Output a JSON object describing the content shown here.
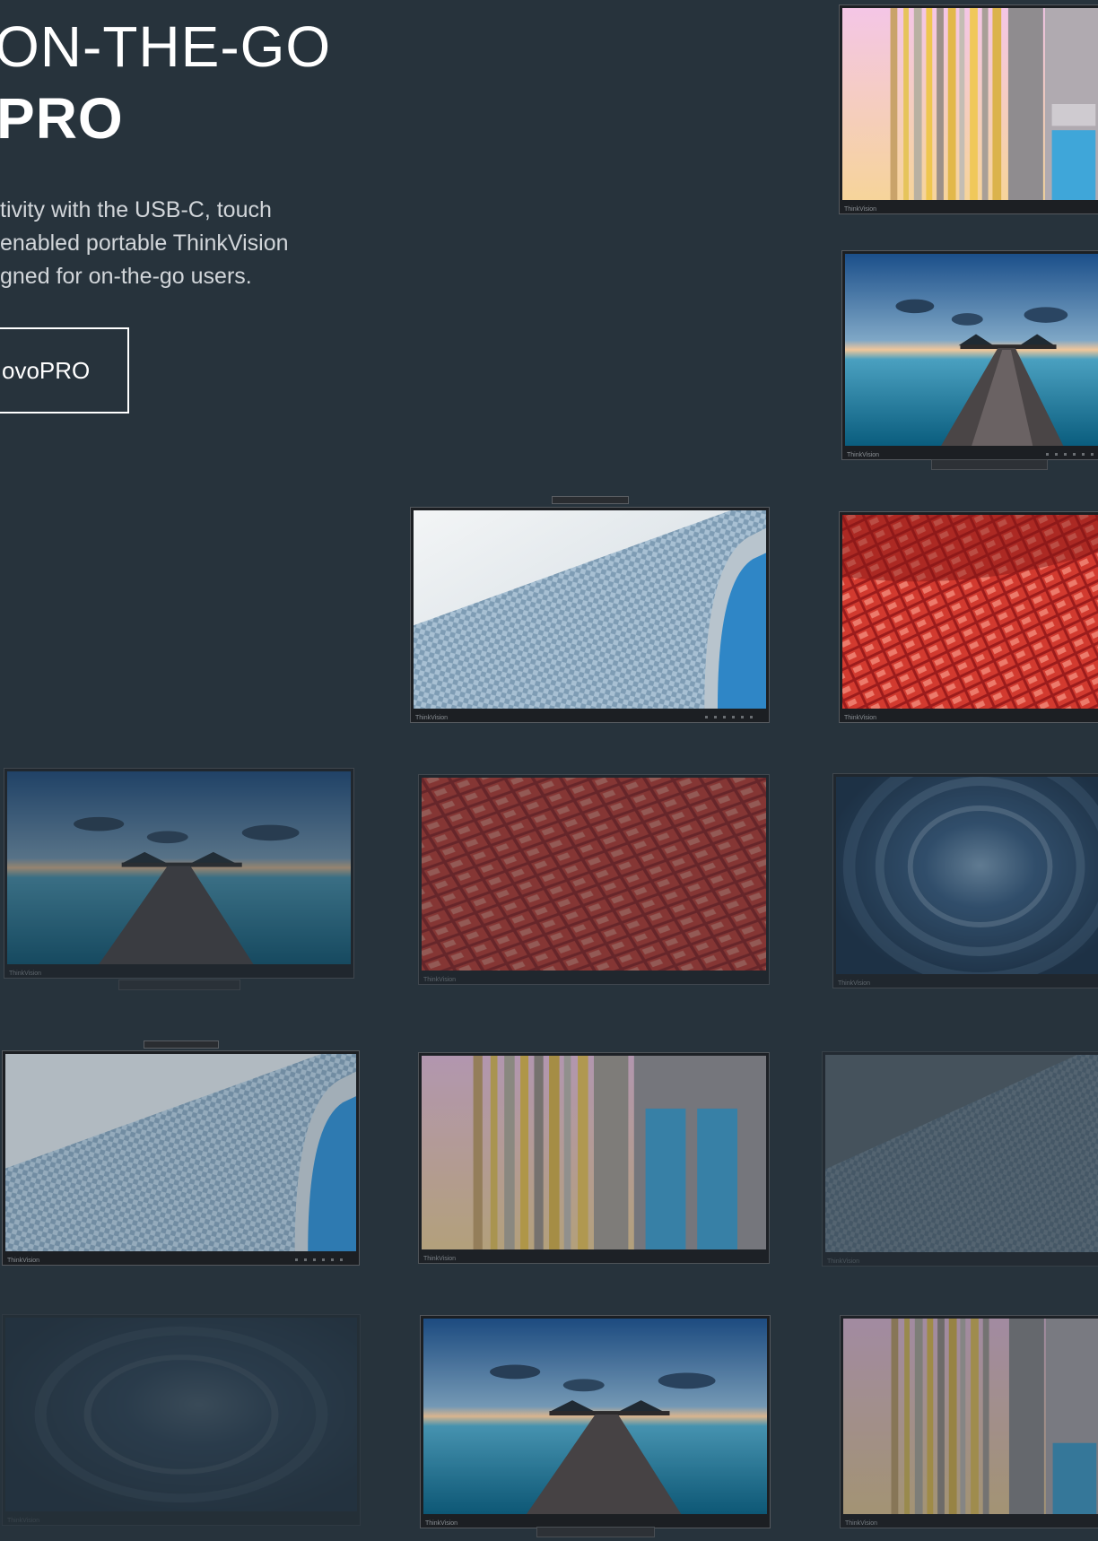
{
  "hero": {
    "title_line1": "ON-THE-GO",
    "title_line2": "PRO",
    "description_lines": [
      "tivity with the USB-C, touch",
      "enabled portable ThinkVision",
      "gned for on-the-go users."
    ],
    "cta_label": "ovoPRO"
  },
  "gallery": {
    "monitor_brand": "ThinkVision",
    "wallpapers": [
      "building-yellow",
      "pier-ocean",
      "facade-blue",
      "tiles-red",
      "tunnel-blue"
    ]
  },
  "colors": {
    "page_background": "#27333c",
    "text": "#ffffff",
    "description_text": "#d2d6da"
  }
}
